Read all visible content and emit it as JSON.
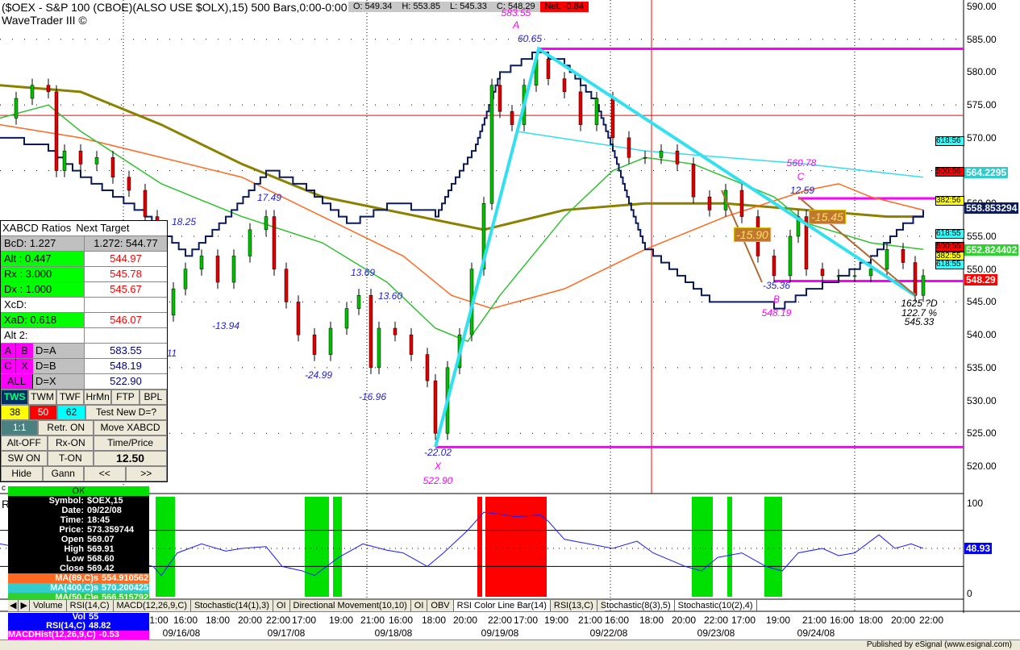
{
  "header": {
    "title": "($OEX - S&P 100 (CBOE)(ALSO USE $OLX),15) 500 Bars,0:00-0:00",
    "subtitle": "WaveTrader III ©",
    "open": "O: 549.34",
    "high": "H: 553.85",
    "low": "L: 545.33",
    "close": "C: 548.29",
    "net": "Net: -0.84"
  },
  "colors": {
    "magenta": "#ff00ff",
    "cyan": "#33ddee",
    "olive": "#8b8000",
    "orange": "#ff6a20",
    "green": "#30c030",
    "navy": "#0a1a5a",
    "rsi": "#1a1aff"
  },
  "chart_data": {
    "type": "candlestick",
    "price_axis": {
      "min": 520,
      "max": 590,
      "ticks": [
        "590.00",
        "585.00",
        "580.00",
        "575.00",
        "570.00",
        "565.00",
        "560.00",
        "555.00",
        "550.00",
        "545.00",
        "540.00",
        "535.00",
        "530.00",
        "525.00",
        "520.00"
      ]
    },
    "closes": [
      [
        0,
        573
      ],
      [
        4,
        576
      ],
      [
        8,
        578
      ],
      [
        12,
        577
      ],
      [
        14,
        565
      ],
      [
        16,
        568
      ],
      [
        20,
        566
      ],
      [
        24,
        567
      ],
      [
        28,
        564
      ],
      [
        32,
        562
      ],
      [
        36,
        558
      ],
      [
        39,
        552
      ],
      [
        41,
        543
      ],
      [
        43,
        547
      ],
      [
        46,
        550
      ],
      [
        50,
        552
      ],
      [
        54,
        548
      ],
      [
        58,
        552
      ],
      [
        62,
        556
      ],
      [
        66,
        558
      ],
      [
        68,
        550
      ],
      [
        71,
        545
      ],
      [
        74,
        540
      ],
      [
        78,
        537
      ],
      [
        82,
        541
      ],
      [
        86,
        544
      ],
      [
        89,
        546
      ],
      [
        92,
        535
      ],
      [
        94,
        541
      ],
      [
        98,
        540
      ],
      [
        102,
        537
      ],
      [
        106,
        533
      ],
      [
        108,
        525
      ],
      [
        111,
        535
      ],
      [
        114,
        540
      ],
      [
        117,
        550
      ],
      [
        120,
        560
      ],
      [
        122,
        578
      ],
      [
        124,
        574
      ],
      [
        127,
        572
      ],
      [
        130,
        578
      ],
      [
        133,
        582
      ],
      [
        136,
        579
      ],
      [
        140,
        577
      ],
      [
        144,
        572
      ],
      [
        148,
        576
      ],
      [
        152,
        570
      ],
      [
        156,
        567
      ],
      [
        160,
        567
      ],
      [
        164,
        568
      ],
      [
        168,
        566
      ],
      [
        172,
        561
      ],
      [
        176,
        559
      ],
      [
        180,
        562
      ],
      [
        184,
        558
      ],
      [
        188,
        552
      ],
      [
        192,
        549
      ],
      [
        196,
        555
      ],
      [
        198,
        558
      ],
      [
        200,
        550
      ],
      [
        204,
        549
      ],
      [
        208,
        549
      ],
      [
        212,
        549
      ],
      [
        216,
        550
      ],
      [
        220,
        553
      ],
      [
        224,
        551
      ],
      [
        227,
        546
      ],
      [
        229,
        549
      ]
    ],
    "ma_olive": [
      [
        0,
        578
      ],
      [
        20,
        577
      ],
      [
        40,
        572
      ],
      [
        60,
        566
      ],
      [
        80,
        561
      ],
      [
        96,
        559
      ],
      [
        112,
        557
      ],
      [
        120,
        556
      ],
      [
        140,
        559
      ],
      [
        160,
        560
      ],
      [
        180,
        560
      ],
      [
        200,
        559
      ],
      [
        220,
        558
      ],
      [
        229,
        558
      ]
    ],
    "ma89_orange": [
      [
        0,
        572
      ],
      [
        20,
        570
      ],
      [
        40,
        567
      ],
      [
        60,
        564
      ],
      [
        80,
        558
      ],
      [
        100,
        552
      ],
      [
        112,
        546
      ],
      [
        122,
        544
      ],
      [
        140,
        547
      ],
      [
        160,
        553
      ],
      [
        180,
        558
      ],
      [
        200,
        562
      ],
      [
        208,
        563
      ],
      [
        216,
        561
      ],
      [
        229,
        559
      ]
    ],
    "ma400_cyan": [
      [
        128,
        571
      ],
      [
        160,
        568
      ],
      [
        200,
        566
      ],
      [
        229,
        564
      ]
    ],
    "ma50_green": [
      [
        0,
        573
      ],
      [
        12,
        575
      ],
      [
        20,
        571
      ],
      [
        40,
        563
      ],
      [
        60,
        558
      ],
      [
        80,
        554
      ],
      [
        96,
        548
      ],
      [
        108,
        541
      ],
      [
        116,
        539
      ],
      [
        124,
        546
      ],
      [
        140,
        558
      ],
      [
        152,
        565
      ],
      [
        160,
        567
      ],
      [
        172,
        566
      ],
      [
        184,
        563
      ],
      [
        192,
        561
      ],
      [
        200,
        557
      ],
      [
        216,
        554
      ],
      [
        229,
        553
      ]
    ],
    "navy_step": [
      [
        0,
        570
      ],
      [
        12,
        568
      ],
      [
        20,
        564
      ],
      [
        36,
        558
      ],
      [
        46,
        552
      ],
      [
        56,
        558
      ],
      [
        66,
        565
      ],
      [
        76,
        562
      ],
      [
        86,
        557
      ],
      [
        96,
        560
      ],
      [
        108,
        558
      ],
      [
        112,
        563
      ],
      [
        118,
        569
      ],
      [
        124,
        580
      ],
      [
        132,
        583
      ],
      [
        140,
        581
      ],
      [
        148,
        575
      ],
      [
        152,
        568
      ],
      [
        156,
        560
      ],
      [
        160,
        553
      ],
      [
        168,
        549
      ],
      [
        176,
        545
      ],
      [
        188,
        545
      ],
      [
        192,
        544
      ],
      [
        200,
        547
      ],
      [
        208,
        549
      ],
      [
        216,
        552
      ],
      [
        224,
        557
      ],
      [
        229,
        559
      ]
    ],
    "xabcd_lines": [
      [
        [
          108,
          522.9
        ],
        [
          133.6,
          583.55
        ],
        [
          227,
          546
        ]
      ]
    ],
    "brown_lines": [
      [
        [
          179,
          562
        ],
        [
          189,
          548
        ]
      ],
      [
        [
          198,
          561
        ],
        [
          227,
          546
        ]
      ]
    ],
    "hlines_magenta": [
      [
        133.6,
        583.55
      ],
      [
        108,
        522.9
      ],
      [
        198,
        560.78
      ],
      [
        192,
        548.19
      ]
    ],
    "hline_red": 573.4,
    "vline_red_bar": 161.6,
    "annotations": [
      "583.55",
      "A",
      "60.65",
      "17.49",
      "18.25",
      "-13.94",
      "11",
      "13.69",
      "13.60",
      "-24.99",
      "-16.96",
      "-22.02",
      "X",
      "522.90",
      "560.78",
      "C",
      "12.59",
      "-35.36",
      "B",
      "548.19",
      "-15.90",
      "-15.45",
      "1625 ?D",
      "122.7 %",
      "545.33"
    ],
    "fib_tags": [
      "618:56",
      "500:56",
      "382:56",
      "618:55",
      "500:55",
      "382:55",
      "618:55"
    ],
    "last_values": [
      "564.2295",
      "558.853294",
      "552.824402",
      "548.29"
    ],
    "rsi": {
      "value": "48.93",
      "ticks": [
        "100",
        "0"
      ],
      "levels": [
        70,
        30
      ],
      "series": [
        [
          0,
          55
        ],
        [
          6,
          50
        ],
        [
          10,
          48
        ],
        [
          16,
          55
        ],
        [
          22,
          52
        ],
        [
          30,
          40
        ],
        [
          38,
          30
        ],
        [
          40,
          20
        ],
        [
          44,
          45
        ],
        [
          50,
          55
        ],
        [
          56,
          47
        ],
        [
          60,
          50
        ],
        [
          66,
          52
        ],
        [
          70,
          30
        ],
        [
          75,
          25
        ],
        [
          78,
          20
        ],
        [
          84,
          40
        ],
        [
          90,
          55
        ],
        [
          96,
          48
        ],
        [
          100,
          45
        ],
        [
          106,
          30
        ],
        [
          110,
          45
        ],
        [
          116,
          70
        ],
        [
          120,
          90
        ],
        [
          124,
          88
        ],
        [
          128,
          85
        ],
        [
          134,
          87
        ],
        [
          136,
          80
        ],
        [
          140,
          60
        ],
        [
          146,
          55
        ],
        [
          152,
          50
        ],
        [
          158,
          58
        ],
        [
          162,
          45
        ],
        [
          170,
          30
        ],
        [
          174,
          25
        ],
        [
          178,
          40
        ],
        [
          184,
          45
        ],
        [
          190,
          30
        ],
        [
          194,
          25
        ],
        [
          198,
          45
        ],
        [
          204,
          50
        ],
        [
          208,
          42
        ],
        [
          212,
          45
        ],
        [
          218,
          65
        ],
        [
          222,
          50
        ],
        [
          226,
          55
        ],
        [
          229,
          50
        ]
      ],
      "green_bands": [
        [
          38.6,
          43.4
        ],
        [
          75.6,
          81.6
        ],
        [
          82.6,
          84.8
        ],
        [
          171.6,
          176.8
        ],
        [
          180.4,
          181.6
        ],
        [
          189.6,
          194
        ]
      ],
      "red_bands": [
        [
          118.4,
          119.6
        ],
        [
          120.4,
          135.6
        ]
      ]
    }
  },
  "time_axis": {
    "times": [
      "1:00",
      "16:00",
      "18:00",
      "20:00",
      "22:00",
      "17:00",
      "19:00",
      "21:00",
      "16:00",
      "18:00",
      "20:00",
      "22:00",
      "17:00",
      "19:00",
      "21:00",
      "16:00",
      "18:00",
      "20:00",
      "22:00",
      "17:00",
      "19:00",
      "21:00",
      "16:00",
      "18:00",
      "20:00",
      "22:00"
    ],
    "dates": [
      "09/16/08",
      "09/17/08",
      "09/18/08",
      "09/19/08",
      "09/22/08",
      "09/23/08",
      "09/24/08"
    ]
  },
  "panel": {
    "title": "XABCD Ratios",
    "next": "Next Target",
    "rows": [
      {
        "k": "BcD:",
        "v": "1.227",
        "t": "1.272: 544.77"
      },
      {
        "k": "Alt  :",
        "v": "0.447",
        "t": "544.97"
      },
      {
        "k": "Rx  :",
        "v": "3.000",
        "t": "545.78"
      },
      {
        "k": "Dx  :",
        "v": "1.000",
        "t": "545.67"
      },
      {
        "k": "XcD:",
        "v": "",
        "t": ""
      },
      {
        "k": "XaD:",
        "v": "0.618",
        "t": "546.07"
      },
      {
        "k": "Alt 2:",
        "v": "",
        "t": ""
      }
    ],
    "dests": [
      {
        "a": "A",
        "b": "B",
        "d": "D=A",
        "v": "583.55"
      },
      {
        "a": "C",
        "b": "X",
        "d": "D=B",
        "v": "548.19"
      },
      {
        "a": "ALL",
        "b": "",
        "d": "D=X",
        "v": "522.90"
      }
    ],
    "btn1": [
      "TWS",
      "TWM",
      "TWF",
      "HrMn",
      "FTP",
      "BPL"
    ],
    "fib": [
      "38",
      "50",
      "62"
    ],
    "test": "Test New D=?",
    "b3": [
      "1:1",
      "Retr. ON",
      "Move XABCD"
    ],
    "b4": [
      "Alt-OFF",
      "Rx-ON",
      "Time/Price"
    ],
    "b5": [
      "SW ON",
      "T-ON",
      "12.50"
    ],
    "b6": [
      "Hide",
      "Gann",
      "<<",
      ">>"
    ]
  },
  "data_window": {
    "ok": "OK",
    "rows": [
      [
        "Symbol:",
        "$OEX,15"
      ],
      [
        "Date:",
        "09/22/08"
      ],
      [
        "Time:",
        "18:45"
      ],
      [
        "Price:",
        "573.359744"
      ],
      [
        "Open",
        "569.07"
      ],
      [
        "High",
        "569.91"
      ],
      [
        "Low",
        "568.60"
      ],
      [
        "Close",
        "569.42"
      ]
    ],
    "ma": [
      [
        "MA(89,C)s",
        "554.910562"
      ],
      [
        "MA(400,C)s",
        "570.200425"
      ],
      [
        "MA(50,C)e",
        "566.515792"
      ]
    ],
    "bottom": [
      [
        "Vol",
        "55"
      ],
      [
        "RSI(14,C)",
        "48.82"
      ],
      [
        "MACDHist(12,26,9,C)",
        "-0.53"
      ]
    ]
  },
  "tabs": [
    "Volume",
    "RSI(14,C)",
    "MACD(12,26,9,C)",
    "Stochastic(14(1),3)",
    "OI",
    "Directional Movement(10,10)",
    "OI",
    "OBV",
    "RSI Color Line Bar(14)",
    "RSI(13,C)",
    "Stochastic(8(3),5)",
    "Stochastic(10(2),4)"
  ],
  "pane_labels": {
    "rsi": "R",
    "c": "c"
  },
  "status": "Published by eSignal (www.esignal.com)"
}
